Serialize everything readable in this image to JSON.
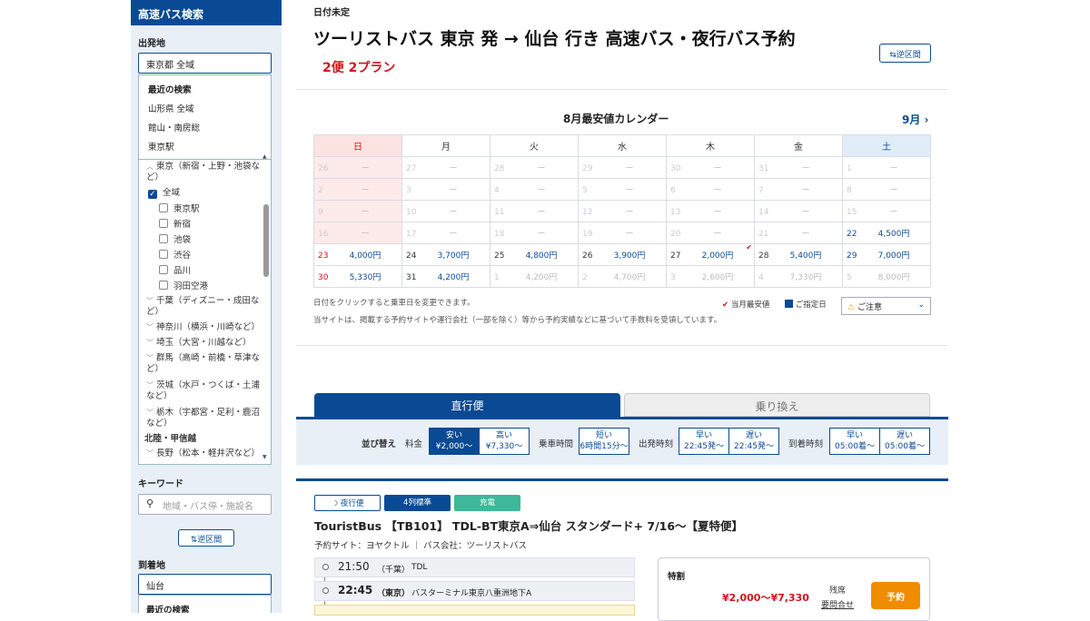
{
  "sidebar": {
    "title": "高速バス検索",
    "departure_label": "出発地",
    "departure_value": "東京都 全域",
    "recent_title": "最近の検索",
    "recent_items": [
      "山形県 全域",
      "館山・南房総",
      "東京駅"
    ],
    "tree": {
      "region_tokyo": "東京（新宿・上野・池袋など）",
      "all": "全域",
      "stations": [
        "東京駅",
        "新宿",
        "池袋",
        "渋谷",
        "品川",
        "羽田空港"
      ],
      "regions": [
        "千葉（ディズニー・成田など）",
        "神奈川（横浜・川崎など）",
        "埼玉（大宮・川越など）",
        "群馬（高崎・前橋・草津など）",
        "茨城（水戸・つくば・土浦など）",
        "栃木（宇都宮・足利・鹿沼など）"
      ],
      "section_hokuriku": "北陸・甲信越",
      "nagano": "長野（松本・軽井沢など）"
    },
    "keyword_label": "キーワード",
    "keyword_placeholder": "地域・バス停・施設名",
    "swap_label": "⇅逆区間",
    "arrival_label": "到着地",
    "arrival_value": "仙台",
    "recent_title2": "最近の検索"
  },
  "header": {
    "date": "日付未定",
    "title": "ツーリストバス 東京 発 → 仙台 行き 高速バス・夜行バス予約",
    "count": "2便 2プラン",
    "swap_label": "⇆逆区間"
  },
  "calendar": {
    "title": "8月最安値カレンダー",
    "next_month": "9月",
    "weekdays": [
      "日",
      "月",
      "火",
      "水",
      "木",
      "金",
      "土"
    ],
    "rows": [
      [
        {
          "d": "26",
          "p": "ー"
        },
        {
          "d": "27",
          "p": "ー"
        },
        {
          "d": "28",
          "p": "ー"
        },
        {
          "d": "29",
          "p": "ー"
        },
        {
          "d": "30",
          "p": "ー"
        },
        {
          "d": "31",
          "p": "ー"
        },
        {
          "d": "1",
          "p": "ー"
        }
      ],
      [
        {
          "d": "2",
          "p": "ー"
        },
        {
          "d": "3",
          "p": "ー"
        },
        {
          "d": "4",
          "p": "ー"
        },
        {
          "d": "5",
          "p": "ー"
        },
        {
          "d": "6",
          "p": "ー"
        },
        {
          "d": "7",
          "p": "ー"
        },
        {
          "d": "8",
          "p": "ー"
        }
      ],
      [
        {
          "d": "9",
          "p": "ー"
        },
        {
          "d": "10",
          "p": "ー"
        },
        {
          "d": "11",
          "p": "ー"
        },
        {
          "d": "12",
          "p": "ー"
        },
        {
          "d": "13",
          "p": "ー"
        },
        {
          "d": "14",
          "p": "ー"
        },
        {
          "d": "15",
          "p": "ー"
        }
      ],
      [
        {
          "d": "16",
          "p": "ー"
        },
        {
          "d": "17",
          "p": "ー"
        },
        {
          "d": "18",
          "p": "ー"
        },
        {
          "d": "19",
          "p": "ー"
        },
        {
          "d": "20",
          "p": "ー"
        },
        {
          "d": "21",
          "p": "ー"
        },
        {
          "d": "22",
          "p": "4,500円"
        }
      ],
      [
        {
          "d": "23",
          "p": "4,000円"
        },
        {
          "d": "24",
          "p": "3,700円"
        },
        {
          "d": "25",
          "p": "4,800円"
        },
        {
          "d": "26",
          "p": "3,900円"
        },
        {
          "d": "27",
          "p": "2,000円"
        },
        {
          "d": "28",
          "p": "5,400円"
        },
        {
          "d": "29",
          "p": "7,000円"
        }
      ],
      [
        {
          "d": "30",
          "p": "5,330円"
        },
        {
          "d": "31",
          "p": "4,200円"
        },
        {
          "d": "1",
          "p": "4,200円"
        },
        {
          "d": "2",
          "p": "4,700円"
        },
        {
          "d": "3",
          "p": "2,600円"
        },
        {
          "d": "4",
          "p": "7,330円"
        },
        {
          "d": "5",
          "p": "8,000円"
        }
      ]
    ],
    "note1": "日付をクリックすると乗車日を変更できます。",
    "note2": "当サイトは、掲載する予約サイトや運行会社（一部を除く）等から予約実績などに基づいて手数料を受領しています。",
    "legend_cheapest": "当月最安値",
    "legend_selected": "ご指定日",
    "caution": "ご注意"
  },
  "tabs": {
    "direct": "直行便",
    "transfer": "乗り換え"
  },
  "sort": {
    "label": "並び替え",
    "price": "料金",
    "price_low": [
      "安い",
      "¥2,000〜"
    ],
    "price_high": [
      "高い",
      "¥7,330〜"
    ],
    "ride_time": "乗車時間",
    "ride_short": [
      "短い",
      "6時間15分〜"
    ],
    "dep_time": "出発時刻",
    "dep_early": [
      "早い",
      "22:45発〜"
    ],
    "dep_late": [
      "遅い",
      "22:45発〜"
    ],
    "arr_time": "到着時刻",
    "arr_early": [
      "早い",
      "05:00着〜"
    ],
    "arr_late": [
      "遅い",
      "05:00着〜"
    ]
  },
  "result": {
    "badges": [
      "夜行便",
      "4列標準",
      "充電"
    ],
    "badge_colors": [
      "#ffffff",
      "#0a4a94",
      "#3db89a"
    ],
    "name": "TouristBus 【TB101】 TDL-BT東京A⇒仙台 スタンダード+ 7/16〜【夏特便】",
    "site": "予約サイト：ヨヤクトル ｜ バス会社：ツーリストバス",
    "stops": [
      {
        "time": "21:50",
        "area": "（千葉）",
        "place": "TDL"
      },
      {
        "time": "22:45",
        "area": "（東京）",
        "place": "バスターミナル東京八重洲地下A"
      }
    ],
    "plan_label": "特割",
    "price": "¥2,000〜¥7,330",
    "seat_label": "残席",
    "seat_value": "要問合せ",
    "reserve": "予約"
  }
}
